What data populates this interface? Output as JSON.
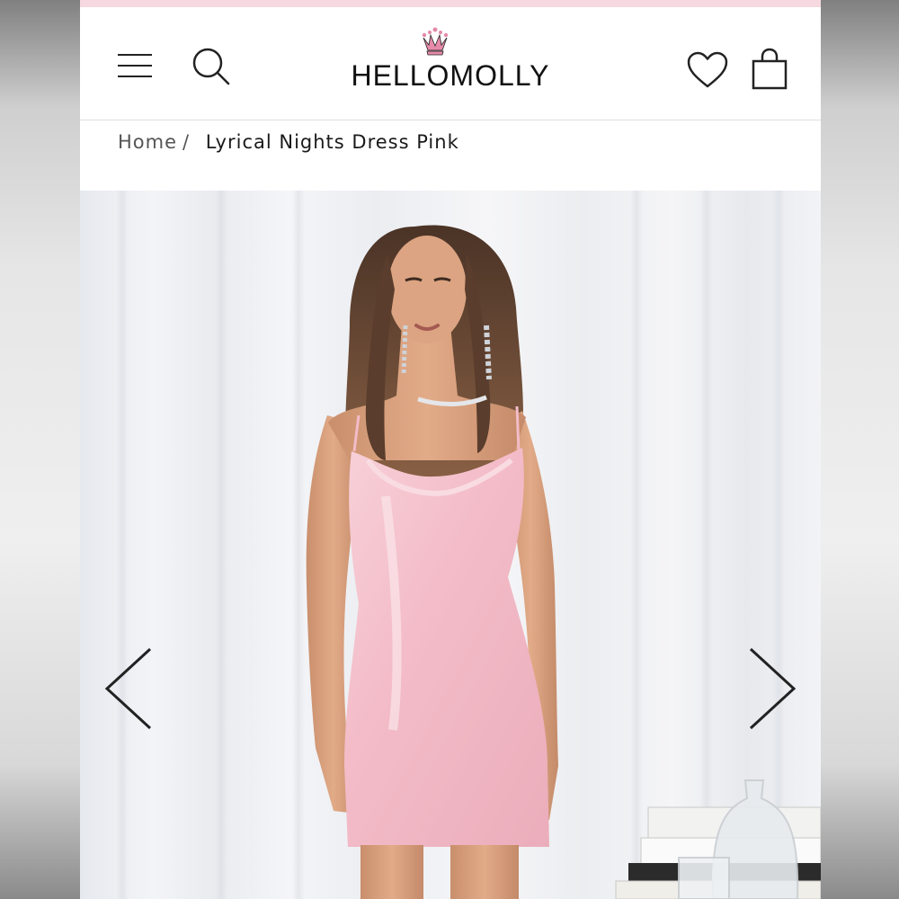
{
  "header": {
    "brand_name": "HELLOMOLLY",
    "icons": {
      "menu": "hamburger-menu-icon",
      "search": "search-icon",
      "logo_crown": "crown-icon",
      "wishlist": "heart-icon",
      "bag": "shopping-bag-icon"
    }
  },
  "breadcrumb": {
    "home_label": "Home",
    "separator": "/",
    "current_label": "Lyrical Nights Dress Pink"
  },
  "gallery": {
    "prev_icon": "chevron-left-icon",
    "next_icon": "chevron-right-icon",
    "image_subject": "model wearing pink sequin cowl neck mini dress"
  },
  "colors": {
    "promo_strip": "#f6d9e0",
    "crown_pink": "#e58aa8",
    "dress_pink": "#f3bcc8",
    "text_dark": "#1a1a1a"
  }
}
